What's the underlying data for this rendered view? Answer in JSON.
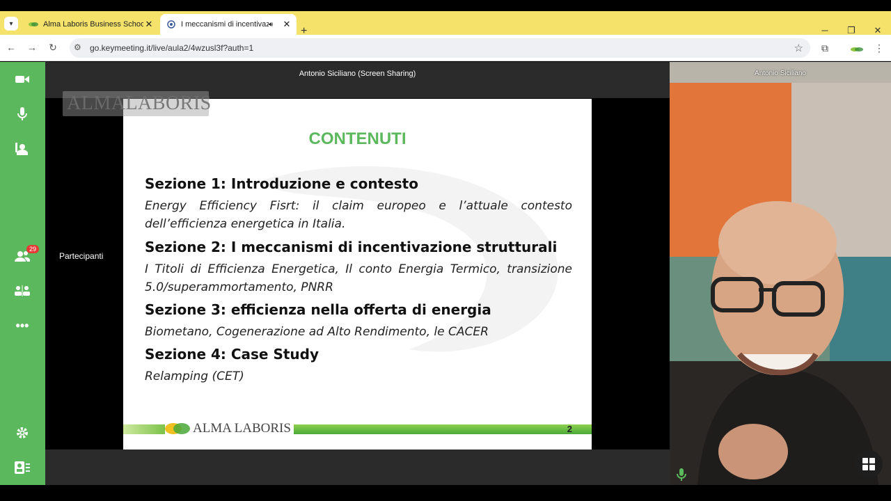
{
  "browser": {
    "tabs": [
      {
        "title": "Alma Laboris Business School",
        "active": false
      },
      {
        "title": "I meccanismi di incentivazio",
        "active": true
      }
    ],
    "url": "go.keymeeting.it/live/aula2/4wzusl3f?auth=1"
  },
  "sidebar": {
    "participants_badge": "29",
    "participants_label": "Partecipanti",
    "accent_color": "#5cb85c"
  },
  "stage": {
    "share_title": "Antonio Siciliano (Screen Sharing)",
    "watermark": "ALMALABORIS"
  },
  "slide": {
    "title": "CONTENUTI",
    "sections": [
      {
        "heading": "Sezione 1: Introduzione e contesto",
        "desc": "Energy Efficiency Fisrt: il claim europeo e l’attuale contesto dell’efficienza energetica in Italia."
      },
      {
        "heading": "Sezione 2: I meccanismi di incentivazione strutturali",
        "desc": "I Titoli di Efficienza Energetica, Il conto Energia Termico, transizione 5.0/superammortamento, PNRR"
      },
      {
        "heading": "Sezione 3: efficienza nella offerta di energia",
        "desc": "Biometano, Cogenerazione ad Alto Rendimento, le CACER"
      },
      {
        "heading": "Sezione 4: Case Study",
        "desc": "Relamping (CET)"
      }
    ],
    "footer_logo": "ALMA LABORIS",
    "page_number": "2"
  },
  "video": {
    "name": "Antonio Siciliano"
  }
}
